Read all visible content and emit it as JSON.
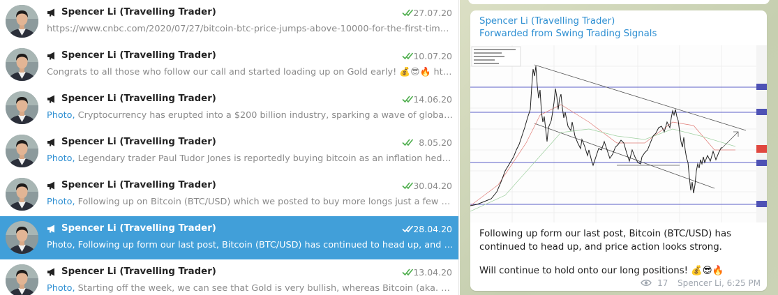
{
  "chats": [
    {
      "title": "Spencer Li (Travelling Trader)",
      "date": "27.07.20",
      "kind": "",
      "preview": "https://www.cnbc.com/2020/07/27/bitcoin-btc-price-jumps-above-10000-for-the-first-time-since-...",
      "selected": false
    },
    {
      "title": "Spencer Li (Travelling Trader)",
      "date": "10.07.20",
      "kind": "",
      "preview": "Congrats to all those who follow our call and started loading up on Gold early! 💰😎🔥 https:/...",
      "selected": false
    },
    {
      "title": "Spencer Li (Travelling Trader)",
      "date": "14.06.20",
      "kind": "Photo,",
      "preview": " Cryptocurrency has erupted into a $200 billion industry, sparking a wave of global disrupt...",
      "selected": false
    },
    {
      "title": "Spencer Li (Travelling Trader)",
      "date": "8.05.20",
      "kind": "Photo,",
      "preview": " Legendary trader Paul Tudor Jones is reportedly buying bitcoin as an inflation hedge as c...",
      "selected": false
    },
    {
      "title": "Spencer Li (Travelling Trader)",
      "date": "30.04.20",
      "kind": "Photo,",
      "preview": " Following up on Bitcoin (BTC/USD) which we posted to buy more longs just a few days ag...",
      "selected": false
    },
    {
      "title": "Spencer Li (Travelling Trader)",
      "date": "28.04.20",
      "kind": "Photo,",
      "preview": " Following up form our last post, Bitcoin (BTC/USD) has continued to head up, and price ac...",
      "selected": true
    },
    {
      "title": "Spencer Li (Travelling Trader)",
      "date": "13.04.20",
      "kind": "Photo,",
      "preview": " Starting off the week, we can see that Gold is very bullish, whereas Bitcoin (aka. digital gol...",
      "selected": false
    }
  ],
  "message": {
    "author": "Spencer Li (Travelling Trader)",
    "forwarded_from": "Forwarded from Swing Trading Signals",
    "text_line1": "Following up form our last post, Bitcoin (BTC/USD) has continued to head up, and price action looks strong.",
    "text_line2": "Will continue to hold onto our long positions! 💰😎🔥",
    "views": "17",
    "signature": "Spencer Li, 6:25 PM"
  },
  "colors": {
    "accent": "#419fd9",
    "link": "#2e8fd2",
    "check": "#4fae4e"
  },
  "icons": [
    "megaphone-icon",
    "double-check-icon",
    "eye-icon"
  ]
}
